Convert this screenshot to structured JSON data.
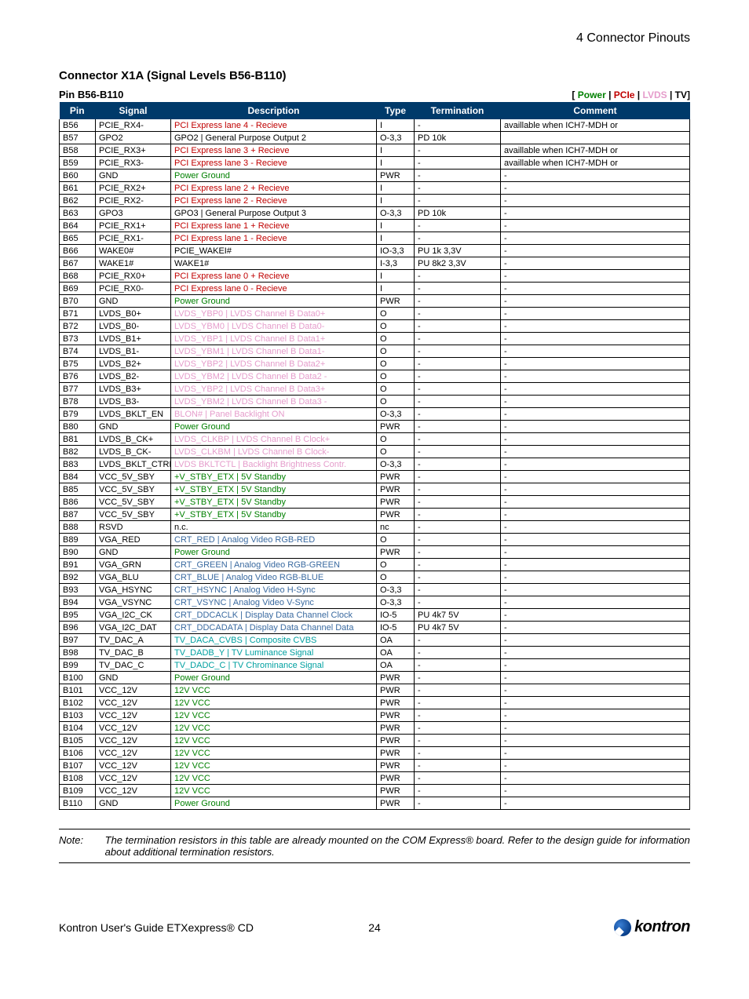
{
  "header": {
    "section": "4 Connector Pinouts"
  },
  "title": "Connector X1A (Signal Levels B56-B110)",
  "subtitle": "Pin B56-B110",
  "legend": {
    "lbracket": "[ ",
    "power": "Power",
    "sep": " | ",
    "pcie": "PCIe",
    "lvds": "LVDS",
    "tv": "TV",
    "rbracket": "]"
  },
  "columns": {
    "pin": "Pin",
    "signal": "Signal",
    "description": "Description",
    "type": "Type",
    "termination": "Termination",
    "comment": "Comment"
  },
  "rows": [
    {
      "pin": "B56",
      "signal": "PCIE_RX4-",
      "desc": "PCI Express lane 4 - Recieve",
      "dclass": "pcie",
      "type": "I",
      "term": "-",
      "comment": "availlable when ICH7-MDH or"
    },
    {
      "pin": "B57",
      "signal": "GPO2",
      "desc": "GPO2 | General Purpose Output 2",
      "dclass": "default",
      "type": "O-3,3",
      "term": "PD 10k",
      "comment": ""
    },
    {
      "pin": "B58",
      "signal": "PCIE_RX3+",
      "desc": "PCI Express lane 3 + Recieve",
      "dclass": "pcie",
      "type": "I",
      "term": "-",
      "comment": "availlable when ICH7-MDH or"
    },
    {
      "pin": "B59",
      "signal": "PCIE_RX3-",
      "desc": "PCI Express lane 3 - Recieve",
      "dclass": "pcie",
      "type": "I",
      "term": "-",
      "comment": "availlable when ICH7-MDH or"
    },
    {
      "pin": "B60",
      "signal": "GND",
      "desc": "Power Ground",
      "dclass": "power",
      "type": "PWR",
      "term": "-",
      "comment": "-"
    },
    {
      "pin": "B61",
      "signal": "PCIE_RX2+",
      "desc": "PCI Express lane 2 + Recieve",
      "dclass": "pcie",
      "type": "I",
      "term": "-",
      "comment": "-"
    },
    {
      "pin": "B62",
      "signal": "PCIE_RX2-",
      "desc": "PCI Express lane 2 - Recieve",
      "dclass": "pcie",
      "type": "I",
      "term": "-",
      "comment": "-"
    },
    {
      "pin": "B63",
      "signal": "GPO3",
      "desc": "GPO3 | General Purpose Output 3",
      "dclass": "default",
      "type": "O-3,3",
      "term": "PD 10k",
      "comment": "-"
    },
    {
      "pin": "B64",
      "signal": "PCIE_RX1+",
      "desc": "PCI Express lane 1 + Recieve",
      "dclass": "pcie",
      "type": "I",
      "term": "-",
      "comment": "-"
    },
    {
      "pin": "B65",
      "signal": "PCIE_RX1-",
      "desc": "PCI Express lane 1 - Recieve",
      "dclass": "pcie",
      "type": "I",
      "term": "-",
      "comment": "-"
    },
    {
      "pin": "B66",
      "signal": "WAKE0#",
      "desc": "PCIE_WAKEI#",
      "dclass": "default",
      "type": "IO-3,3",
      "term": "PU 1k 3,3V",
      "comment": "-"
    },
    {
      "pin": "B67",
      "signal": "WAKE1#",
      "desc": "WAKE1#",
      "dclass": "default",
      "type": "I-3,3",
      "term": "PU 8k2 3,3V",
      "comment": "-"
    },
    {
      "pin": "B68",
      "signal": "PCIE_RX0+",
      "desc": "PCI Express lane 0 + Recieve",
      "dclass": "pcie",
      "type": "I",
      "term": "-",
      "comment": "-"
    },
    {
      "pin": "B69",
      "signal": "PCIE_RX0-",
      "desc": "PCI Express lane 0 - Recieve",
      "dclass": "pcie",
      "type": "I",
      "term": "-",
      "comment": "-"
    },
    {
      "pin": "B70",
      "signal": "GND",
      "desc": "Power Ground",
      "dclass": "power",
      "type": "PWR",
      "term": "-",
      "comment": "-"
    },
    {
      "pin": "B71",
      "signal": "LVDS_B0+",
      "desc": "LVDS_YBP0 | LVDS Channel B Data0+",
      "dclass": "lvds",
      "type": "O",
      "term": "-",
      "comment": "-"
    },
    {
      "pin": "B72",
      "signal": "LVDS_B0-",
      "desc": "LVDS_YBM0 | LVDS Channel B Data0-",
      "dclass": "lvds",
      "type": "O",
      "term": "-",
      "comment": "-"
    },
    {
      "pin": "B73",
      "signal": "LVDS_B1+",
      "desc": "LVDS_YBP1 | LVDS Channel B Data1+",
      "dclass": "lvds",
      "type": "O",
      "term": "-",
      "comment": "-"
    },
    {
      "pin": "B74",
      "signal": "LVDS_B1-",
      "desc": "LVDS_YBM1 | LVDS Channel B Data1-",
      "dclass": "lvds",
      "type": "O",
      "term": "-",
      "comment": "-"
    },
    {
      "pin": "B75",
      "signal": "LVDS_B2+",
      "desc": "LVDS_YBP2 | LVDS Channel B Data2+",
      "dclass": "lvds",
      "type": "O",
      "term": "-",
      "comment": "-"
    },
    {
      "pin": "B76",
      "signal": "LVDS_B2-",
      "desc": "LVDS_YBM2 | LVDS Channel B Data2 -",
      "dclass": "lvds",
      "type": "O",
      "term": "-",
      "comment": "-"
    },
    {
      "pin": "B77",
      "signal": "LVDS_B3+",
      "desc": "LVDS_YBP2 | LVDS Channel B Data3+",
      "dclass": "lvds",
      "type": "O",
      "term": "-",
      "comment": "-"
    },
    {
      "pin": "B78",
      "signal": "LVDS_B3-",
      "desc": "LVDS_YBM2 | LVDS Channel B Data3 -",
      "dclass": "lvds",
      "type": "O",
      "term": "-",
      "comment": "-"
    },
    {
      "pin": "B79",
      "signal": "LVDS_BKLT_EN",
      "desc": "BLON# | Panel Backlight ON",
      "dclass": "lvds",
      "type": "O-3,3",
      "term": "-",
      "comment": "-"
    },
    {
      "pin": "B80",
      "signal": "GND",
      "desc": "Power Ground",
      "dclass": "power",
      "type": "PWR",
      "term": "-",
      "comment": "-"
    },
    {
      "pin": "B81",
      "signal": "LVDS_B_CK+",
      "desc": "LVDS_CLKBP | LVDS Channel B Clock+",
      "dclass": "lvds",
      "type": "O",
      "term": "-",
      "comment": "-"
    },
    {
      "pin": "B82",
      "signal": "LVDS_B_CK-",
      "desc": "LVDS_CLKBM | LVDS Channel B Clock-",
      "dclass": "lvds",
      "type": "O",
      "term": "-",
      "comment": "-"
    },
    {
      "pin": "B83",
      "signal": "LVDS_BKLT_CTRL",
      "desc": "LVDS BKLTCTL | Backlight Brightness Contr.",
      "dclass": "lvds",
      "type": "O-3,3",
      "term": "-",
      "comment": "-"
    },
    {
      "pin": "B84",
      "signal": "VCC_5V_SBY",
      "desc": "+V_STBY_ETX | 5V Standby",
      "dclass": "power",
      "type": "PWR",
      "term": "-",
      "comment": "-"
    },
    {
      "pin": "B85",
      "signal": "VCC_5V_SBY",
      "desc": "+V_STBY_ETX | 5V Standby",
      "dclass": "power",
      "type": "PWR",
      "term": "-",
      "comment": "-"
    },
    {
      "pin": "B86",
      "signal": "VCC_5V_SBY",
      "desc": "+V_STBY_ETX | 5V Standby",
      "dclass": "power",
      "type": "PWR",
      "term": "-",
      "comment": "-"
    },
    {
      "pin": "B87",
      "signal": "VCC_5V_SBY",
      "desc": "+V_STBY_ETX | 5V Standby",
      "dclass": "power",
      "type": "PWR",
      "term": "-",
      "comment": "-"
    },
    {
      "pin": "B88",
      "signal": "RSVD",
      "desc": "n.c.",
      "dclass": "default",
      "type": "nc",
      "term": "-",
      "comment": "-"
    },
    {
      "pin": "B89",
      "signal": "VGA_RED",
      "desc": "CRT_RED | Analog Video RGB-RED",
      "dclass": "vga",
      "type": "O",
      "term": "-",
      "comment": "-"
    },
    {
      "pin": "B90",
      "signal": "GND",
      "desc": "Power Ground",
      "dclass": "power",
      "type": "PWR",
      "term": "-",
      "comment": "-"
    },
    {
      "pin": "B91",
      "signal": "VGA_GRN",
      "desc": "CRT_GREEN | Analog Video RGB-GREEN",
      "dclass": "vga",
      "type": "O",
      "term": "-",
      "comment": "-"
    },
    {
      "pin": "B92",
      "signal": "VGA_BLU",
      "desc": "CRT_BLUE | Analog Video RGB-BLUE",
      "dclass": "vga",
      "type": "O",
      "term": "-",
      "comment": "-"
    },
    {
      "pin": "B93",
      "signal": "VGA_HSYNC",
      "desc": "CRT_HSYNC | Analog Video H-Sync",
      "dclass": "vga",
      "type": "O-3,3",
      "term": "-",
      "comment": "-"
    },
    {
      "pin": "B94",
      "signal": "VGA_VSYNC",
      "desc": "CRT_VSYNC | Analog Video V-Sync",
      "dclass": "vga",
      "type": "O-3,3",
      "term": "-",
      "comment": "-"
    },
    {
      "pin": "B95",
      "signal": "VGA_I2C_CK",
      "desc": "CRT_DDCACLK | Display Data Channel Clock",
      "dclass": "vga",
      "type": "IO-5",
      "term": "PU 4k7 5V",
      "comment": "-"
    },
    {
      "pin": "B96",
      "signal": "VGA_I2C_DAT",
      "desc": "CRT_DDCADATA | Display Data Channel Data",
      "dclass": "vga",
      "type": "IO-5",
      "term": "PU 4k7 5V",
      "comment": "-"
    },
    {
      "pin": "B97",
      "signal": "TV_DAC_A",
      "desc": "TV_DACA_CVBS | Composite CVBS",
      "dclass": "tv",
      "type": "OA",
      "term": "-",
      "comment": "-"
    },
    {
      "pin": "B98",
      "signal": "TV_DAC_B",
      "desc": "TV_DADB_Y | TV Luminance Signal",
      "dclass": "tv",
      "type": "OA",
      "term": "-",
      "comment": "-"
    },
    {
      "pin": "B99",
      "signal": "TV_DAC_C",
      "desc": "TV_DADC_C | TV Chrominance Signal",
      "dclass": "tv",
      "type": "OA",
      "term": "-",
      "comment": "-"
    },
    {
      "pin": "B100",
      "signal": "GND",
      "desc": "Power Ground",
      "dclass": "power",
      "type": "PWR",
      "term": "-",
      "comment": "-"
    },
    {
      "pin": "B101",
      "signal": "VCC_12V",
      "desc": "12V VCC",
      "dclass": "power",
      "type": "PWR",
      "term": "-",
      "comment": "-"
    },
    {
      "pin": "B102",
      "signal": "VCC_12V",
      "desc": "12V VCC",
      "dclass": "power",
      "type": "PWR",
      "term": "-",
      "comment": "-"
    },
    {
      "pin": "B103",
      "signal": "VCC_12V",
      "desc": "12V VCC",
      "dclass": "power",
      "type": "PWR",
      "term": "-",
      "comment": "-"
    },
    {
      "pin": "B104",
      "signal": "VCC_12V",
      "desc": "12V VCC",
      "dclass": "power",
      "type": "PWR",
      "term": "-",
      "comment": "-"
    },
    {
      "pin": "B105",
      "signal": "VCC_12V",
      "desc": "12V VCC",
      "dclass": "power",
      "type": "PWR",
      "term": "-",
      "comment": "-"
    },
    {
      "pin": "B106",
      "signal": "VCC_12V",
      "desc": "12V VCC",
      "dclass": "power",
      "type": "PWR",
      "term": "-",
      "comment": "-"
    },
    {
      "pin": "B107",
      "signal": "VCC_12V",
      "desc": "12V VCC",
      "dclass": "power",
      "type": "PWR",
      "term": "-",
      "comment": "-"
    },
    {
      "pin": "B108",
      "signal": "VCC_12V",
      "desc": "12V VCC",
      "dclass": "power",
      "type": "PWR",
      "term": "-",
      "comment": "-"
    },
    {
      "pin": "B109",
      "signal": "VCC_12V",
      "desc": "12V VCC",
      "dclass": "power",
      "type": "PWR",
      "term": "-",
      "comment": "-"
    },
    {
      "pin": "B110",
      "signal": "GND",
      "desc": "Power Ground",
      "dclass": "power",
      "type": "PWR",
      "term": "-",
      "comment": "-"
    }
  ],
  "note": {
    "label": "Note:",
    "text": "The termination resistors in this table are already mounted on the COM Express® board. Refer to the design guide for information about additional termination resistors."
  },
  "footer": {
    "left": "Kontron User's Guide ETXexpress® CD",
    "center": "24",
    "logo_text": "kontron"
  },
  "colors": {
    "default": "#000000",
    "power": "#008000",
    "pcie": "#c00000",
    "lvds": "#e59ccb",
    "tv": "#00a0a0",
    "vga": "#3a6aa0"
  }
}
